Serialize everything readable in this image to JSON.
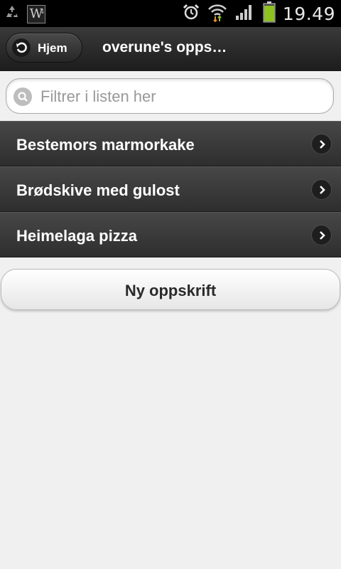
{
  "status_bar": {
    "time": "19.49",
    "icons": [
      "recycle-icon",
      "w4-app-icon",
      "alarm-icon",
      "wifi-icon",
      "signal-icon",
      "battery-icon"
    ],
    "w4_label": "W",
    "w4_sup": "4",
    "battery_color": "#8ec21f"
  },
  "header": {
    "back_label": "Hjem",
    "title": "overune's opps…"
  },
  "filter": {
    "placeholder": "Filtrer i listen her",
    "value": ""
  },
  "list": {
    "items": [
      {
        "label": "Bestemors marmorkake"
      },
      {
        "label": "Brødskive med gulost"
      },
      {
        "label": "Heimelaga pizza"
      }
    ]
  },
  "actions": {
    "new_recipe_label": "Ny oppskrift"
  }
}
